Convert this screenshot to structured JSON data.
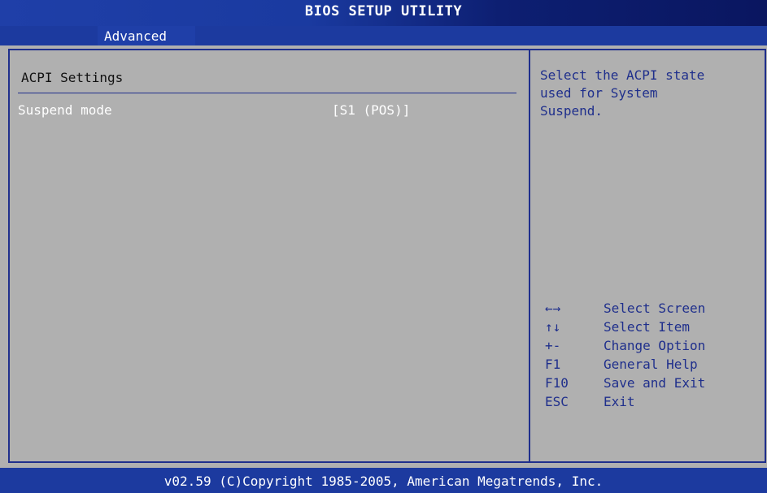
{
  "header": {
    "title": "BIOS SETUP UTILITY",
    "active_tab": "Advanced"
  },
  "panel": {
    "section_title": "ACPI Settings",
    "settings": [
      {
        "label": "Suspend mode",
        "value": "[S1 (POS)]"
      }
    ]
  },
  "help": {
    "text": "Select the ACPI state\nused for System\nSuspend."
  },
  "keys": [
    {
      "key": "←→",
      "desc": "Select Screen"
    },
    {
      "key": "↑↓",
      "desc": "Select Item"
    },
    {
      "key": "+-",
      "desc": "Change Option"
    },
    {
      "key": "F1",
      "desc": "General Help"
    },
    {
      "key": "F10",
      "desc": "Save and Exit"
    },
    {
      "key": "ESC",
      "desc": "Exit"
    }
  ],
  "footer": {
    "text": "v02.59 (C)Copyright 1985-2005, American Megatrends, Inc."
  },
  "colors": {
    "header_blue": "#1c3a9f",
    "panel_gray": "#b0b0b0",
    "accent_blue": "#1f2f8c",
    "text_white": "#ffffff"
  }
}
